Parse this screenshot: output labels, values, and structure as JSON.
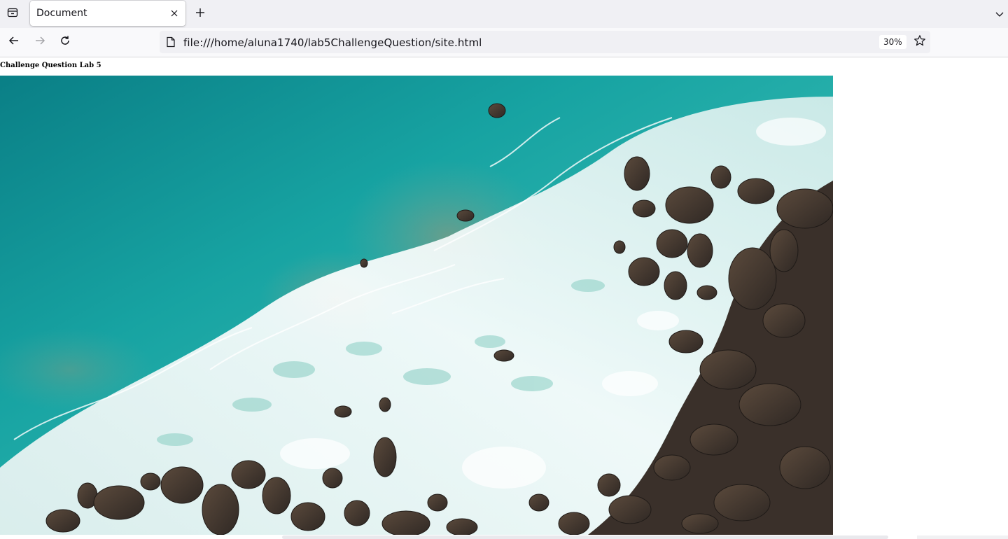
{
  "browser": {
    "tab": {
      "title": "Document"
    },
    "toolbar": {
      "url": "file:///home/aluna1740/lab5ChallengeQuestion/site.html",
      "zoom": "30%"
    },
    "icons": [
      "tab-list-icon",
      "close-icon",
      "plus-icon",
      "chevron-down-icon",
      "back-arrow-icon",
      "forward-arrow-icon",
      "reload-icon",
      "page-icon",
      "star-icon"
    ]
  },
  "page": {
    "heading": "Challenge Question Lab 5",
    "image": {
      "subject": "aerial view of turquoise sea waves breaking on rocky shore"
    }
  },
  "colors": {
    "sea_deep": "#0f8a8a",
    "sea_turquoise": "#1aa7a6",
    "foam": "#f2f6f6",
    "rock_dark": "#3a3430",
    "rock_brown": "#6b5440",
    "chrome_bg": "#f0f0f4"
  }
}
